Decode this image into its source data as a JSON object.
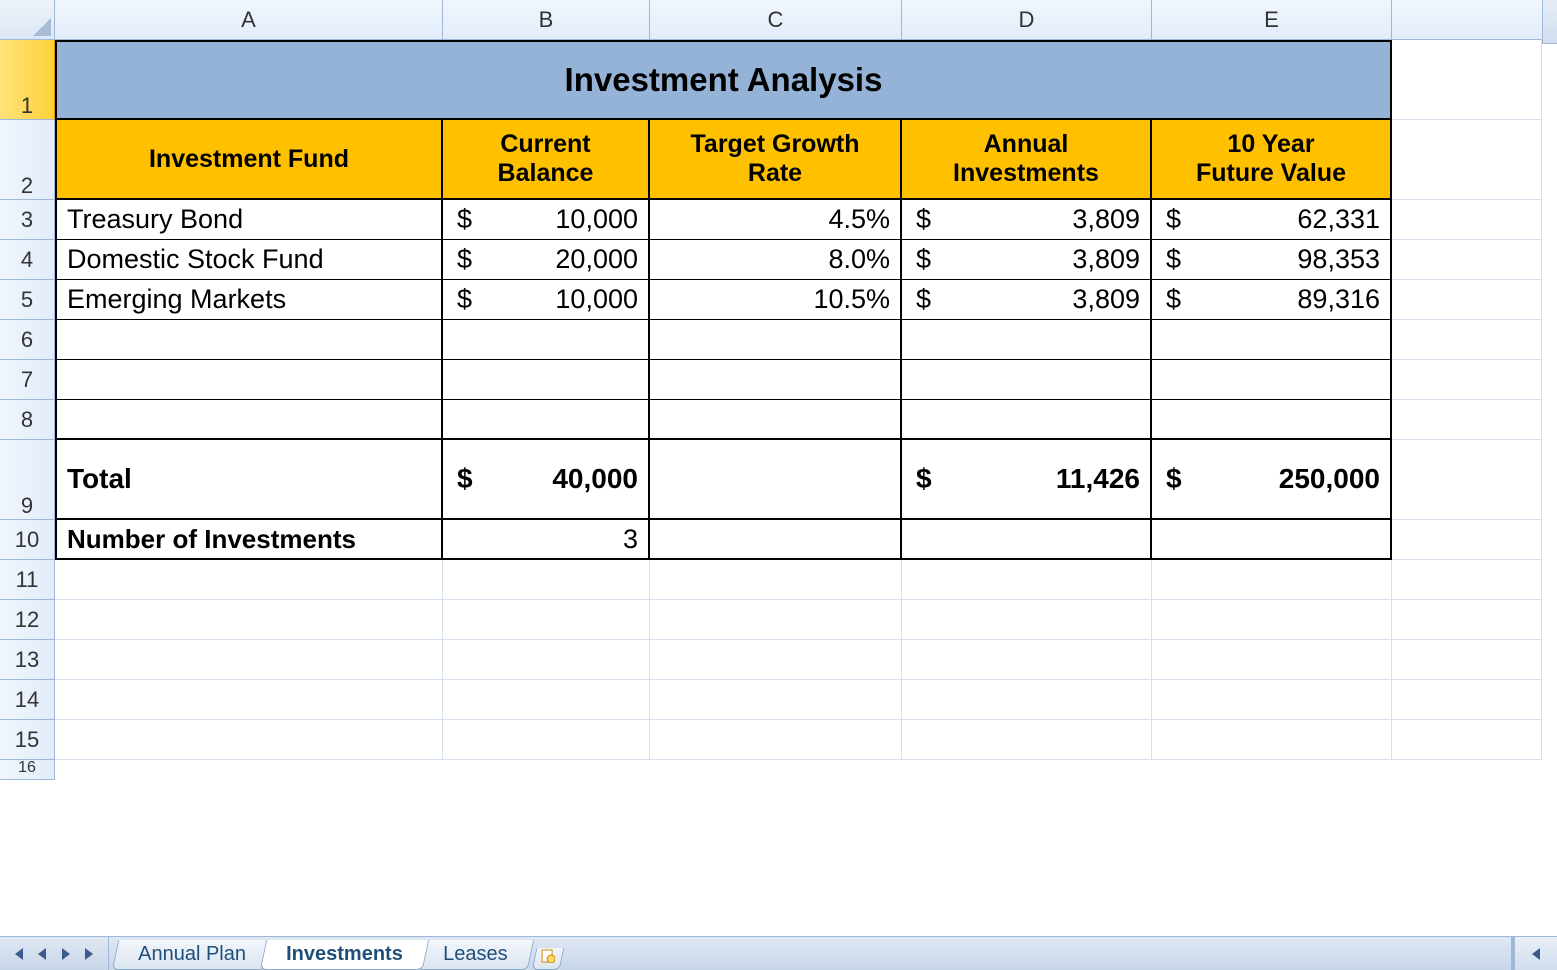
{
  "columns": [
    "A",
    "B",
    "C",
    "D",
    "E"
  ],
  "row_headers": [
    "1",
    "2",
    "3",
    "4",
    "5",
    "6",
    "7",
    "8",
    "9",
    "10",
    "11",
    "12",
    "13",
    "14",
    "15",
    "16"
  ],
  "title": "Investment Analysis",
  "headers": {
    "a": "Investment Fund",
    "b": "Current\nBalance",
    "c": "Target Growth\nRate",
    "d": "Annual\nInvestments",
    "e": "10 Year\nFuture Value"
  },
  "rows": [
    {
      "fund": "Treasury Bond",
      "balance": "10,000",
      "rate": "4.5%",
      "annual": "3,809",
      "future": "62,331"
    },
    {
      "fund": "Domestic Stock Fund",
      "balance": "20,000",
      "rate": "8.0%",
      "annual": "3,809",
      "future": "98,353"
    },
    {
      "fund": "Emerging Markets",
      "balance": "10,000",
      "rate": "10.5%",
      "annual": "3,809",
      "future": "89,316"
    }
  ],
  "total": {
    "label": "Total",
    "balance": "40,000",
    "annual": "11,426",
    "future": "250,000"
  },
  "count": {
    "label": "Number of Investments",
    "value": "3"
  },
  "currency_symbol": "$",
  "tabs": {
    "t1": "Annual Plan",
    "t2": "Investments",
    "t3": "Leases"
  },
  "chart_data": {
    "type": "table",
    "title": "Investment Analysis",
    "columns": [
      "Investment Fund",
      "Current Balance ($)",
      "Target Growth Rate (%)",
      "Annual Investments ($)",
      "10 Year Future Value ($)"
    ],
    "rows": [
      [
        "Treasury Bond",
        10000,
        4.5,
        3809,
        62331
      ],
      [
        "Domestic Stock Fund",
        20000,
        8.0,
        3809,
        98353
      ],
      [
        "Emerging Markets",
        10000,
        10.5,
        3809,
        89316
      ]
    ],
    "totals": {
      "Current Balance ($)": 40000,
      "Annual Investments ($)": 11426,
      "10 Year Future Value ($)": 250000
    },
    "number_of_investments": 3
  }
}
